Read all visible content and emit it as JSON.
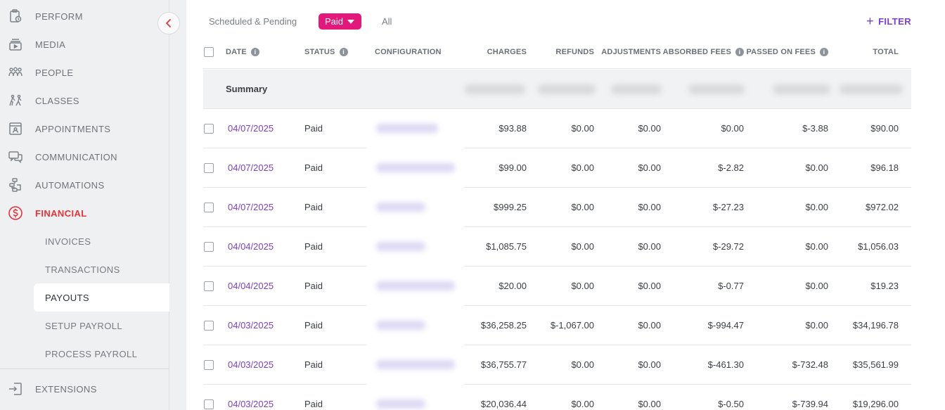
{
  "sidebar": {
    "collapse_icon": "chevron-left-icon",
    "accent_color": "#e3343a",
    "items": [
      {
        "label": "PERFORM",
        "icon": "clipboard-icon"
      },
      {
        "label": "MEDIA",
        "icon": "media-icon"
      },
      {
        "label": "PEOPLE",
        "icon": "people-icon"
      },
      {
        "label": "CLASSES",
        "icon": "classes-icon"
      },
      {
        "label": "APPOINTMENTS",
        "icon": "calendar-icon"
      },
      {
        "label": "COMMUNICATION",
        "icon": "chat-icon"
      },
      {
        "label": "AUTOMATIONS",
        "icon": "automation-icon"
      },
      {
        "label": "FINANCIAL",
        "icon": "dollar-icon",
        "active": true
      }
    ],
    "financial_subitems": [
      {
        "label": "INVOICES"
      },
      {
        "label": "TRANSACTIONS"
      },
      {
        "label": "PAYOUTS",
        "selected": true
      },
      {
        "label": "SETUP PAYROLL"
      },
      {
        "label": "PROCESS PAYROLL"
      }
    ],
    "footer_item": {
      "label": "EXTENSIONS",
      "icon": "extensions-icon"
    }
  },
  "filters": {
    "tabs": [
      {
        "label": "Scheduled & Pending"
      },
      {
        "label": "Paid",
        "selected": true
      },
      {
        "label": "All"
      }
    ],
    "selected_color": "#e3187a",
    "filter_button": "FILTER"
  },
  "table": {
    "columns": {
      "date": "DATE",
      "status": "STATUS",
      "configuration": "CONFIGURATION",
      "charges": "CHARGES",
      "refunds": "REFUNDS",
      "adjustments": "ADJUSTMENTS",
      "absorbed_fees": "ABSORBED FEES",
      "passed_on_fees": "PASSED ON FEES",
      "total": "TOTAL"
    },
    "summary_label": "Summary",
    "rows": [
      {
        "date": "04/07/2025",
        "status": "Paid",
        "charges": "$93.88",
        "refunds": "$0.00",
        "adjustments": "$0.00",
        "absorbed_fees": "$0.00",
        "passed_on_fees": "$-3.88",
        "total": "$90.00"
      },
      {
        "date": "04/07/2025",
        "status": "Paid",
        "charges": "$99.00",
        "refunds": "$0.00",
        "adjustments": "$0.00",
        "absorbed_fees": "$-2.82",
        "passed_on_fees": "$0.00",
        "total": "$96.18"
      },
      {
        "date": "04/07/2025",
        "status": "Paid",
        "charges": "$999.25",
        "refunds": "$0.00",
        "adjustments": "$0.00",
        "absorbed_fees": "$-27.23",
        "passed_on_fees": "$0.00",
        "total": "$972.02"
      },
      {
        "date": "04/04/2025",
        "status": "Paid",
        "charges": "$1,085.75",
        "refunds": "$0.00",
        "adjustments": "$0.00",
        "absorbed_fees": "$-29.72",
        "passed_on_fees": "$0.00",
        "total": "$1,056.03"
      },
      {
        "date": "04/04/2025",
        "status": "Paid",
        "charges": "$20.00",
        "refunds": "$0.00",
        "adjustments": "$0.00",
        "absorbed_fees": "$-0.77",
        "passed_on_fees": "$0.00",
        "total": "$19.23"
      },
      {
        "date": "04/03/2025",
        "status": "Paid",
        "charges": "$36,258.25",
        "refunds": "$-1,067.00",
        "adjustments": "$0.00",
        "absorbed_fees": "$-994.47",
        "passed_on_fees": "$0.00",
        "total": "$34,196.78"
      },
      {
        "date": "04/03/2025",
        "status": "Paid",
        "charges": "$36,755.77",
        "refunds": "$0.00",
        "adjustments": "$0.00",
        "absorbed_fees": "$-461.30",
        "passed_on_fees": "$-732.48",
        "total": "$35,561.99"
      },
      {
        "date": "04/03/2025",
        "status": "Paid",
        "charges": "$20,036.44",
        "refunds": "$0.00",
        "adjustments": "$0.00",
        "absorbed_fees": "$-0.50",
        "passed_on_fees": "$-739.94",
        "total": "$19,296.00"
      }
    ]
  }
}
